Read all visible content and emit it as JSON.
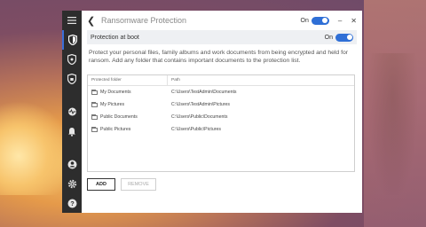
{
  "window": {
    "title": "Ransomware Protection",
    "toggle_label": "On",
    "minimize_glyph": "–",
    "close_glyph": "✕"
  },
  "boot": {
    "label": "Protection at boot",
    "toggle_label": "On"
  },
  "description": "Protect your personal files, family albums and work documents from being encrypted and held for ransom. Add any folder that contains important documents to the protection list.",
  "table": {
    "headers": [
      "Protected folder",
      "Path"
    ],
    "rows": [
      {
        "folder": "My Documents",
        "path": "C:\\Users\\TestAdmin\\Documents"
      },
      {
        "folder": "My Pictures",
        "path": "C:\\Users\\TestAdmin\\Pictures"
      },
      {
        "folder": "Public Documents",
        "path": "C:\\Users\\Public\\Documents"
      },
      {
        "folder": "Public Pictures",
        "path": "C:\\Users\\Public\\Pictures"
      }
    ]
  },
  "buttons": {
    "add": "ADD",
    "remove": "REMOVE"
  },
  "sidebar": {
    "icons": [
      "menu-icon",
      "shield-icon",
      "shield-star-icon",
      "shield-lock-icon",
      "heartbeat-icon",
      "bell-icon",
      "account-icon",
      "gear-icon",
      "help-icon"
    ]
  },
  "colors": {
    "accent": "#2f6fd6",
    "sidebar": "#2d2d2d"
  }
}
